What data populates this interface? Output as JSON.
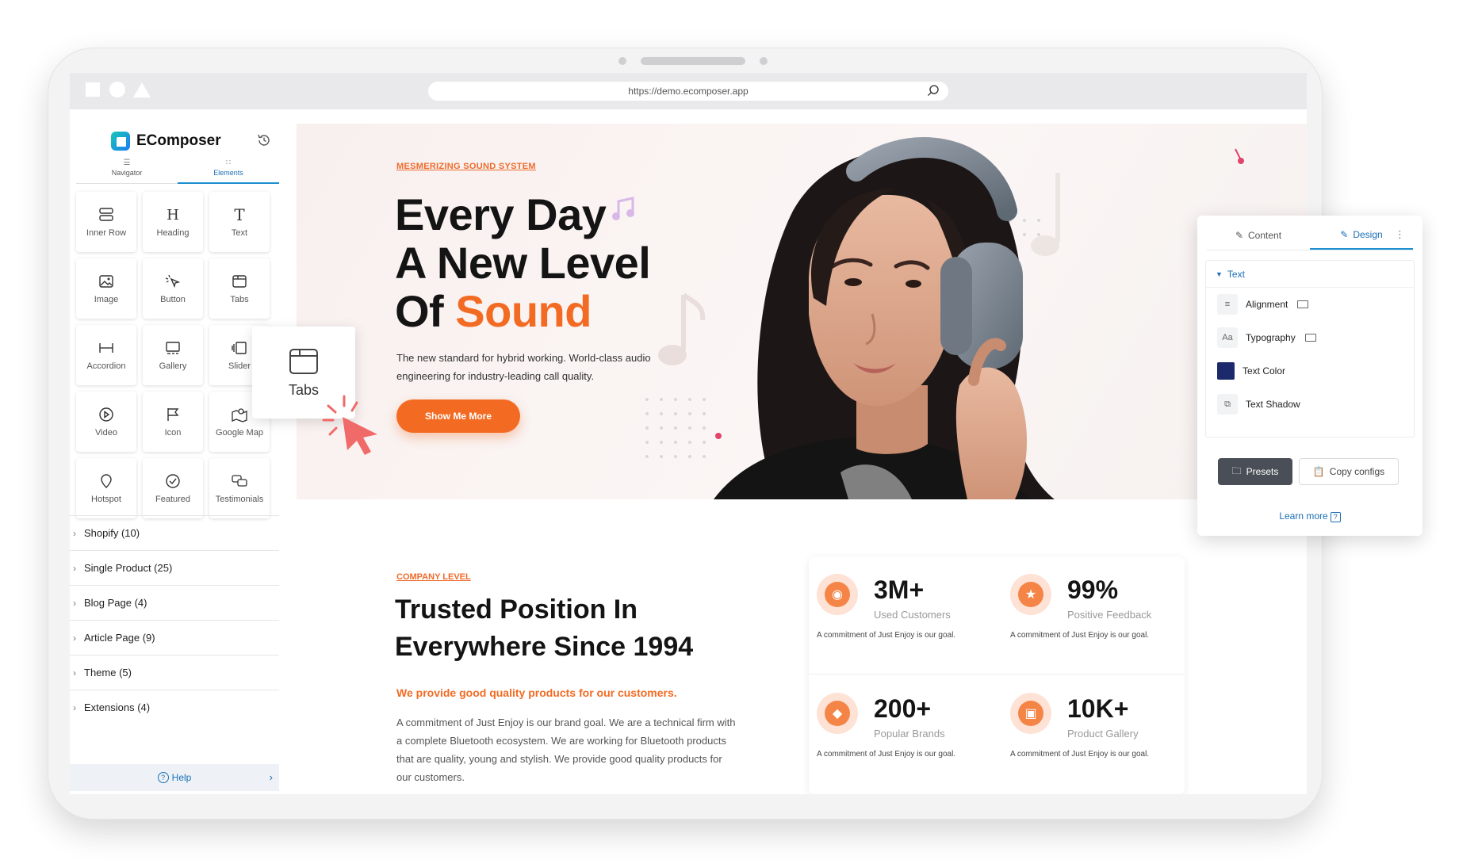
{
  "browser": {
    "url": "https://demo.ecomposer.app"
  },
  "sidebar": {
    "brand": "EComposer",
    "tabs": [
      {
        "label": "Navigator",
        "icon": "layers-icon",
        "active": false
      },
      {
        "label": "Elements",
        "icon": "grid-icon",
        "active": true
      }
    ],
    "elements": [
      {
        "label": "Inner Row",
        "icon": "inner-row-icon"
      },
      {
        "label": "Heading",
        "icon": "heading-icon"
      },
      {
        "label": "Text",
        "icon": "text-icon"
      },
      {
        "label": "Image",
        "icon": "image-icon"
      },
      {
        "label": "Button",
        "icon": "button-icon"
      },
      {
        "label": "Tabs",
        "icon": "tabs-icon"
      },
      {
        "label": "Accordion",
        "icon": "accordion-icon"
      },
      {
        "label": "Gallery",
        "icon": "gallery-icon"
      },
      {
        "label": "Slider",
        "icon": "slider-icon"
      },
      {
        "label": "Video",
        "icon": "video-icon"
      },
      {
        "label": "Icon",
        "icon": "flag-icon"
      },
      {
        "label": "Google Map",
        "icon": "map-icon"
      },
      {
        "label": "Hotspot",
        "icon": "hotspot-icon"
      },
      {
        "label": "Featured",
        "icon": "featured-icon"
      },
      {
        "label": "Testimonials",
        "icon": "testimonials-icon"
      }
    ],
    "categories": [
      "Shopify (10)",
      "Single Product (25)",
      "Blog Page (4)",
      "Article Page (9)",
      "Theme (5)",
      "Extensions (4)"
    ],
    "help_label": "Help"
  },
  "tooltip": {
    "label": "Tabs"
  },
  "hero": {
    "tag": "MESMERIZING SOUND SYSTEM",
    "title_line1": "Every Day",
    "title_line2": "A New Level",
    "title_line3_prefix": "Of",
    "title_line3_accent": "Sound",
    "description": "The new standard for hybrid working. World-class audio engineering for industry-leading call quality.",
    "button": "Show Me More"
  },
  "company": {
    "tag": "COMPANY LEVEL",
    "title": "Trusted Position In Everywhere Since 1994",
    "subtitle": "We provide good quality products for our customers.",
    "description": "A commitment of Just Enjoy is our brand goal. We are a technical firm with a complete Bluetooth ecosystem. We are working for Bluetooth products that are quality, young and stylish. We provide good quality products for our customers."
  },
  "stats": [
    {
      "value": "3M+",
      "label": "Used Customers",
      "note": "A commitment of Just Enjoy is our goal."
    },
    {
      "value": "99%",
      "label": "Positive Feedback",
      "note": "A commitment of Just Enjoy is our goal."
    },
    {
      "value": "200+",
      "label": "Popular Brands",
      "note": "A commitment of Just Enjoy is our goal."
    },
    {
      "value": "10K+",
      "label": "Product Gallery",
      "note": "A commitment of Just Enjoy is our goal."
    }
  ],
  "panel": {
    "tabs": [
      {
        "label": "Content",
        "active": false
      },
      {
        "label": "Design",
        "active": true
      }
    ],
    "section_title": "Text",
    "rows": [
      "Alignment",
      "Typography",
      "Text Color",
      "Text Shadow"
    ],
    "presets_label": "Presets",
    "copy_label": "Copy configs",
    "learn_more": "Learn more"
  },
  "colors": {
    "accent": "#f36b23",
    "brand_blue": "#1b6fb5",
    "text_color_swatch": "#1c2a6b"
  }
}
